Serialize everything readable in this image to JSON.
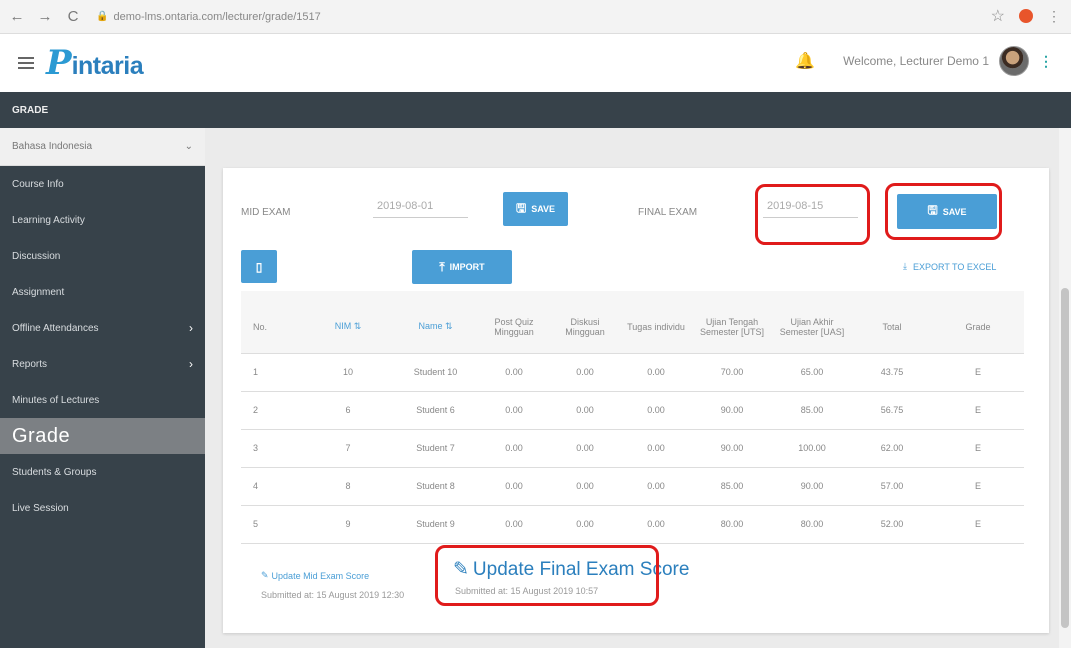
{
  "browser": {
    "back": "←",
    "forward": "→",
    "reload": "C",
    "url": "demo-lms.ontaria.com/lecturer/grade/1517"
  },
  "header": {
    "logo_mark": "P",
    "logo_text": "intaria",
    "welcome": "Welcome, Lecturer Demo 1"
  },
  "page_title": "GRADE",
  "sidebar": {
    "course": "Bahasa Indonesia",
    "items": [
      {
        "label": "Course Info"
      },
      {
        "label": "Learning Activity"
      },
      {
        "label": "Discussion"
      },
      {
        "label": "Assignment"
      },
      {
        "label": "Offline Attendances"
      },
      {
        "label": "Reports"
      },
      {
        "label": "Minutes of Lectures"
      },
      {
        "label": "Grade"
      },
      {
        "label": "Students & Groups"
      },
      {
        "label": "Live Session"
      }
    ]
  },
  "form": {
    "mid_label": "MID EXAM",
    "mid_date": "2019-08-01",
    "final_label": "FINAL EXAM",
    "final_date": "2019-08-15",
    "save_label": "SAVE",
    "import_label": "IMPORT",
    "export_label": "EXPORT TO EXCEL"
  },
  "table": {
    "headers": [
      "No.",
      "NIM",
      "Name",
      "Post Quiz Mingguan",
      "Diskusi Mingguan",
      "Tugas individu",
      "Ujian Tengah Semester [UTS]",
      "Ujian Akhir Semester [UAS]",
      "Total",
      "Grade"
    ],
    "rows": [
      [
        "1",
        "10",
        "Student 10",
        "0.00",
        "0.00",
        "0.00",
        "70.00",
        "65.00",
        "43.75",
        "E"
      ],
      [
        "2",
        "6",
        "Student 6",
        "0.00",
        "0.00",
        "0.00",
        "90.00",
        "85.00",
        "56.75",
        "E"
      ],
      [
        "3",
        "7",
        "Student 7",
        "0.00",
        "0.00",
        "0.00",
        "90.00",
        "100.00",
        "62.00",
        "E"
      ],
      [
        "4",
        "8",
        "Student 8",
        "0.00",
        "0.00",
        "0.00",
        "85.00",
        "90.00",
        "57.00",
        "E"
      ],
      [
        "5",
        "9",
        "Student 9",
        "0.00",
        "0.00",
        "0.00",
        "80.00",
        "80.00",
        "52.00",
        "E"
      ]
    ]
  },
  "footer": {
    "update_mid": "Update Mid Exam Score",
    "mid_submitted": "Submitted at: 15 August 2019 12:30",
    "update_final": "Update Final Exam Score",
    "final_submitted": "Submitted at: 15 August 2019 10:57"
  },
  "colors": {
    "accent": "#4a9ed6",
    "sidebar": "#37424a",
    "highlight": "#e01b1b"
  }
}
